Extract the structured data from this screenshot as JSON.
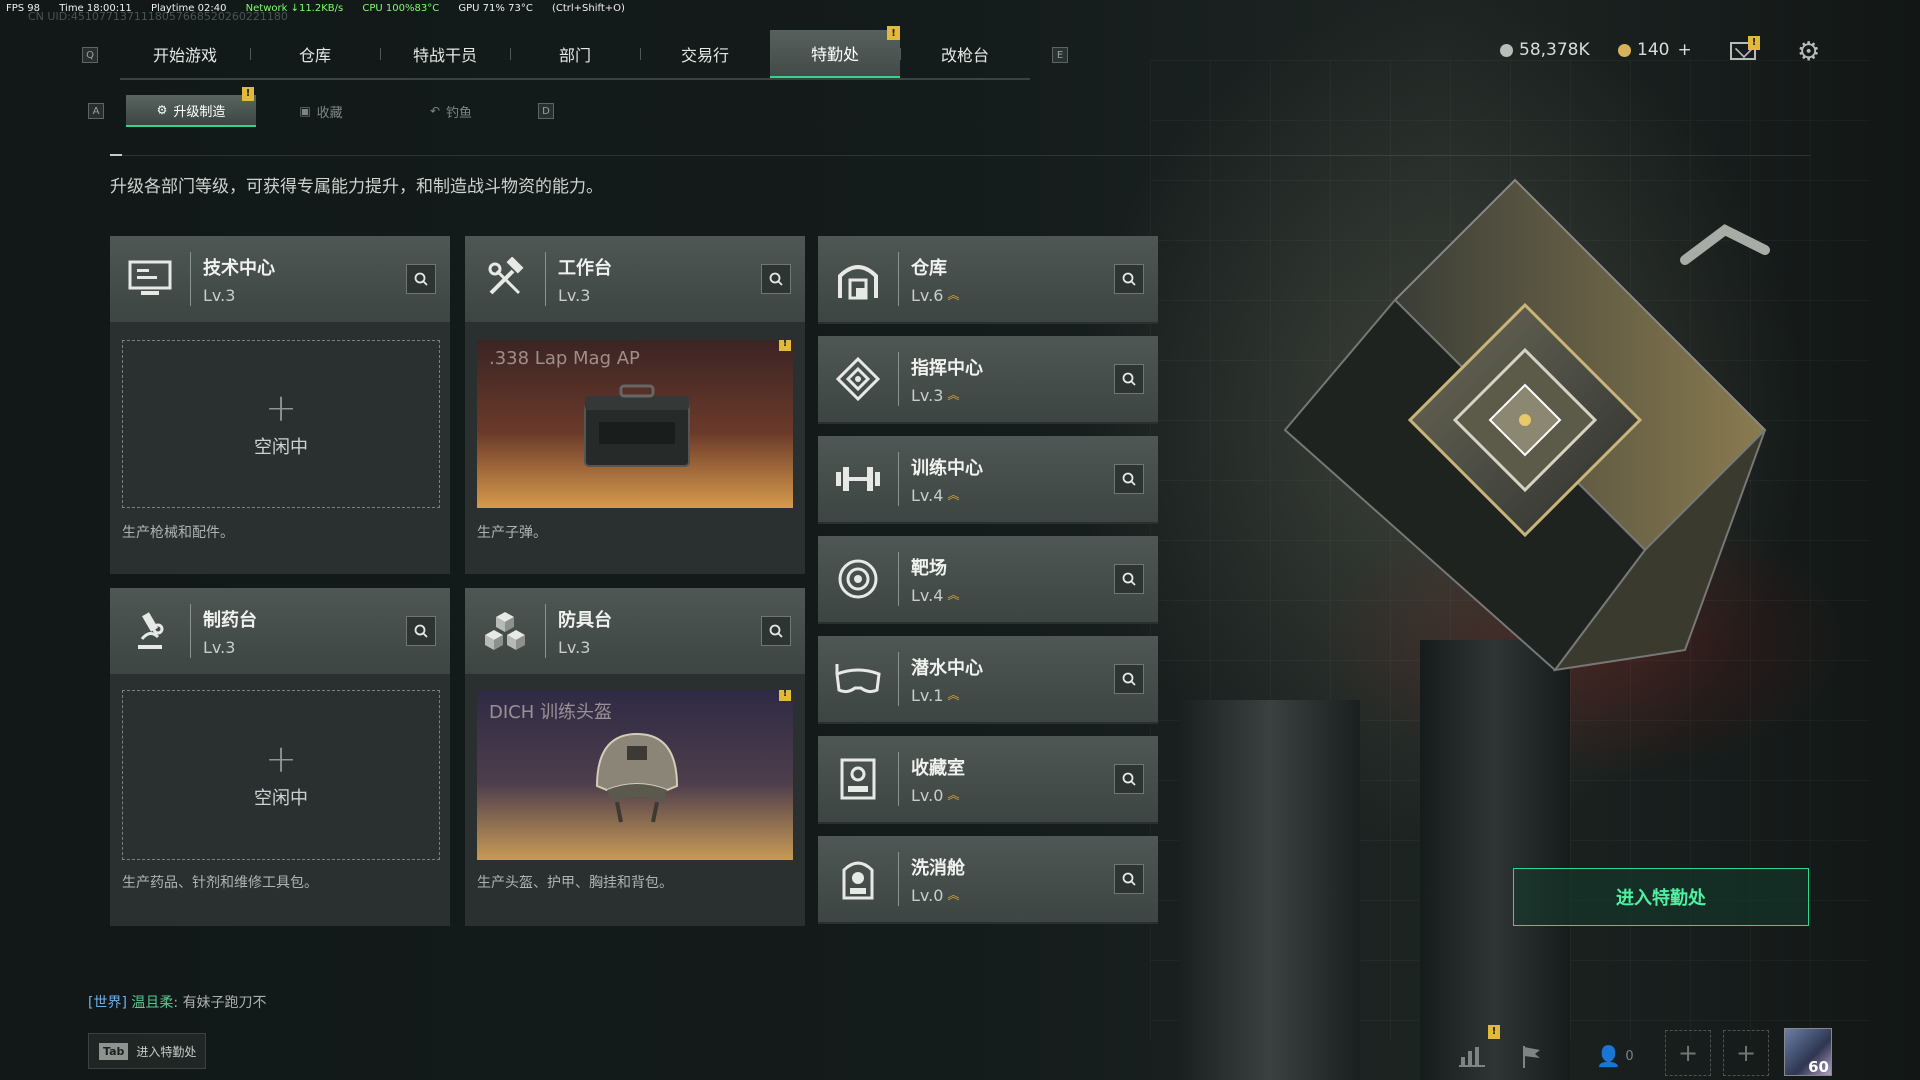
{
  "debug": {
    "fps": "FPS 98",
    "time": "Time 18:00:11",
    "playtime": "Playtime 02:40",
    "network": "Network ↓11.2KB/s",
    "cpu": "CPU 100%83°C",
    "gpu": "GPU 71% 73°C",
    "hotkey": "(Ctrl+Shift+O)",
    "uid": "CN UID:4510771371118057668520260221180"
  },
  "topnav": {
    "key_left": "Q",
    "key_right": "E",
    "tabs": [
      {
        "label": "开始游戏"
      },
      {
        "label": "仓库"
      },
      {
        "label": "特战干员"
      },
      {
        "label": "部门"
      },
      {
        "label": "交易行"
      },
      {
        "label": "特勤处",
        "alert": "!"
      },
      {
        "label": "改枪台"
      }
    ]
  },
  "resources": {
    "currency1": "58,378K",
    "currency2": "140",
    "currency2_add": "+",
    "mail_alert": "!"
  },
  "subnav": {
    "key_left": "A",
    "key_right": "D",
    "tabs": [
      {
        "label": "升级制造",
        "alert": "!"
      },
      {
        "label": "收藏"
      },
      {
        "label": "钓鱼"
      }
    ]
  },
  "description": "升级各部门等级，可获得专属能力提升，和制造战斗物资的能力。",
  "craft_cards": [
    {
      "name": "技术中心",
      "level": "Lv.3",
      "status": "空闲中",
      "desc": "生产枪械和配件。"
    },
    {
      "name": "工作台",
      "level": "Lv.3",
      "item": ".338 Lap Mag AP",
      "alert": "!",
      "desc": "生产子弹。"
    },
    {
      "name": "制药台",
      "level": "Lv.3",
      "status": "空闲中",
      "desc": "生产药品、针剂和维修工具包。"
    },
    {
      "name": "防具台",
      "level": "Lv.3",
      "item": "DICH 训练头盔",
      "alert": "!",
      "desc": "生产头盔、护甲、胸挂和背包。"
    }
  ],
  "facilities": [
    {
      "name": "仓库",
      "level": "Lv.6"
    },
    {
      "name": "指挥中心",
      "level": "Lv.3"
    },
    {
      "name": "训练中心",
      "level": "Lv.4"
    },
    {
      "name": "靶场",
      "level": "Lv.4"
    },
    {
      "name": "潜水中心",
      "level": "Lv.1"
    },
    {
      "name": "收藏室",
      "level": "Lv.0"
    },
    {
      "name": "洗消舱",
      "level": "Lv.0"
    }
  ],
  "enter_button": "进入特勤处",
  "chat": {
    "channel": "[世界]",
    "user": "温且柔:",
    "message": "有妹子跑刀不"
  },
  "tab_hint": {
    "key": "Tab",
    "label": "进入特勤处"
  },
  "bottom_right": {
    "friends_count": "0",
    "avatar_level": "60",
    "stats_alert": "!"
  },
  "colors": {
    "accent": "#2bd98a",
    "alert": "#e2b93b",
    "upgrade": "#d9a23a"
  }
}
